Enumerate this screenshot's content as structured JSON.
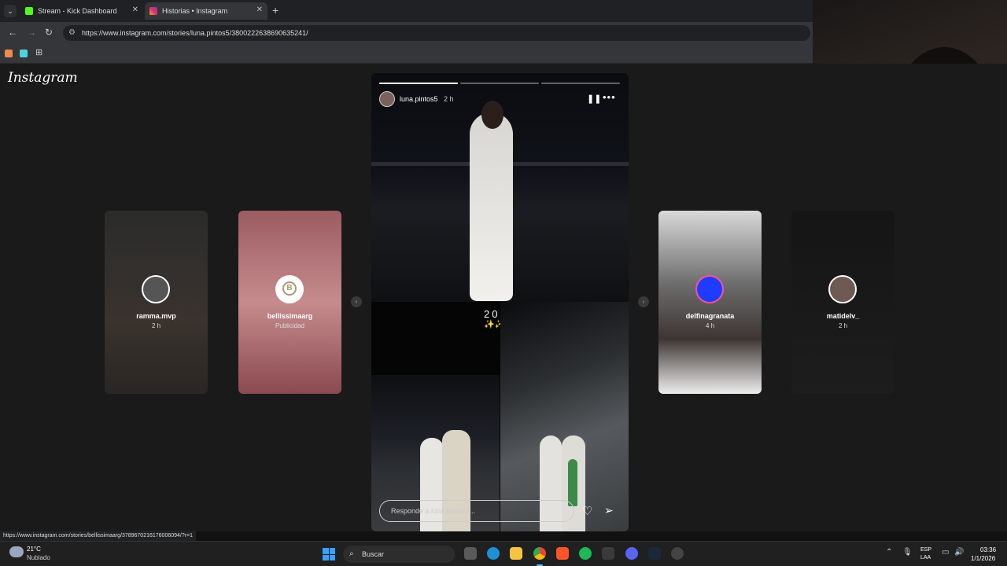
{
  "browser": {
    "tabs": [
      {
        "label": "Stream - Kick Dashboard",
        "favicon_color": "#53fc18"
      },
      {
        "label": "Historias • Instagram",
        "favicon_color": "#e1306c",
        "active": true
      }
    ],
    "url": "https://www.instagram.com/stories/luna.pintos5/3800222638690635241/",
    "status_url": "https://www.instagram.com/stories/bellissimaarg/3789670216176006094/?r=1"
  },
  "instagram": {
    "logo": "Instagram",
    "main_story": {
      "username": "luna.pintos5",
      "time": "2 h",
      "year_text": "2026",
      "sparkles": "✨✨✨",
      "reply_placeholder": "Responde a luna.pintos5...",
      "progress": [
        1.0,
        0.0,
        0.0
      ]
    },
    "side_stories": [
      {
        "username": "ramma.mvp",
        "meta": "2 h"
      },
      {
        "username": "bellissimaarg",
        "meta": "Publicidad"
      },
      {
        "username": "delfinagranata",
        "meta": "4 h"
      },
      {
        "username": "matidelv_",
        "meta": "2 h"
      }
    ]
  },
  "taskbar": {
    "weather_temp": "21°C",
    "weather_desc": "Nublado",
    "search_label": "Buscar",
    "lang_top": "ESP",
    "lang_bottom": "LAA",
    "time": "03:36",
    "date": "1/1/2026",
    "apps": [
      "file-explorer-icon",
      "edge-icon",
      "folder-icon",
      "chrome-icon",
      "brave-icon",
      "spotify-icon",
      "epic-games-icon",
      "discord-icon",
      "steam-icon",
      "obs-icon"
    ]
  },
  "colors": {
    "accent": "#4cc2ff",
    "instagram_ring": "#ff4f9a"
  }
}
